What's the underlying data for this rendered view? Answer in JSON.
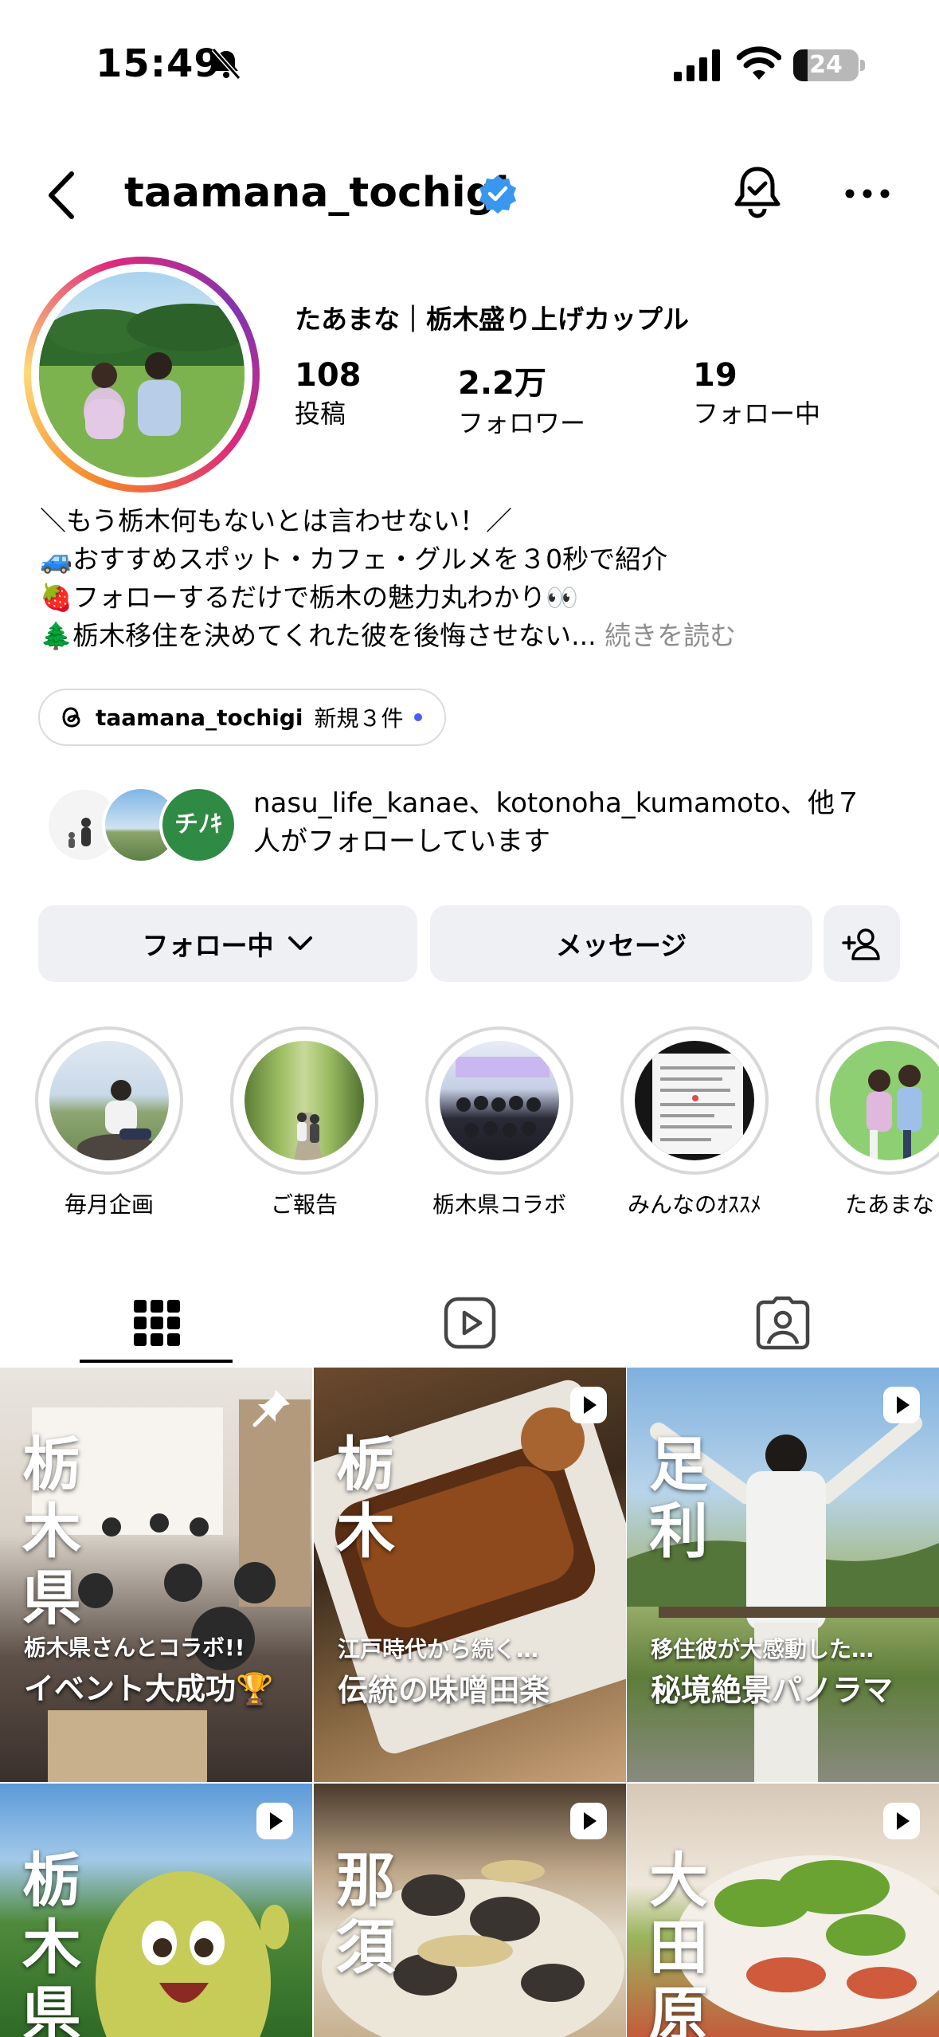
{
  "status_bar": {
    "time": "15:49",
    "battery": "24"
  },
  "header": {
    "username": "taamana_tochigi"
  },
  "profile": {
    "display_name": "たあまな｜栃木盛り上げカップル",
    "stats": [
      {
        "value": "108",
        "label": "投稿"
      },
      {
        "value": "2.2万",
        "label": "フォロワー"
      },
      {
        "value": "19",
        "label": "フォロー中"
      }
    ],
    "bio": [
      "＼もう栃木何もないとは言わせない！／",
      "🚙おすすめスポット・カフェ・グルメを３0秒で紹介",
      "🍓フォローするだけで栃木の魅力丸わかり👀",
      "🌲栃木移住を決めてくれた彼を後悔させない..."
    ],
    "bio_more": "続きを読む",
    "threads": {
      "handle": "taamana_tochigi",
      "badge": "新規３件"
    },
    "followed_by_line1": "nasu_life_kanae、kotonoha_kumamoto、他７",
    "followed_by_line2": "人がフォローしています",
    "followed_avatar_text": "チﾉｷ"
  },
  "actions": {
    "follow_label": "フォロー中",
    "message_label": "メッセージ"
  },
  "highlights": [
    {
      "label": "毎月企画"
    },
    {
      "label": "ご報告"
    },
    {
      "label": "栃木県コラボ"
    },
    {
      "label": "みんなのｵｽｽﾒ"
    },
    {
      "label": "たあまな"
    }
  ],
  "grid": [
    {
      "big": "栃木県",
      "sub": "栃木県さんとコラボ!!",
      "main": "イベント大成功🏆",
      "pinned": true
    },
    {
      "big": "栃木",
      "sub": "江戸時代から続く…",
      "main": "伝統の味噌田楽",
      "reel": true
    },
    {
      "big": "足利",
      "sub": "移住彼が大感動した…",
      "main": "秘境絶景パノラマ",
      "reel": true
    },
    {
      "big": "栃木県",
      "reel": true
    },
    {
      "big": "那須",
      "reel": true
    },
    {
      "big": "大田原",
      "reel": true
    }
  ]
}
